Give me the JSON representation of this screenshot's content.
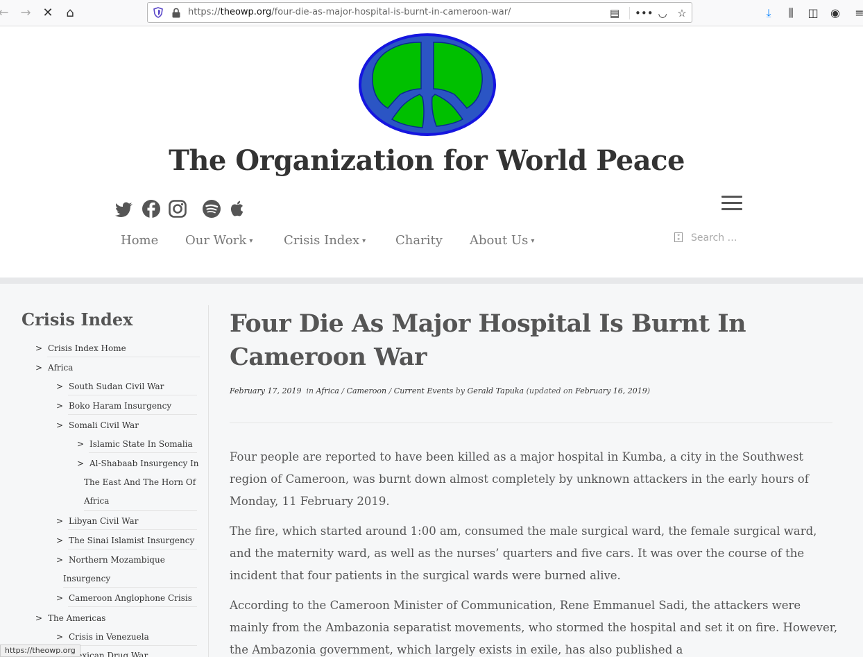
{
  "browser": {
    "url_prefix": "https://",
    "url_host": "theowp.org",
    "url_path": "/four-die-as-major-hospital-is-burnt-in-cameroon-war/",
    "status_url": "https://theowp.org"
  },
  "site": {
    "title": "The Organization for World Peace",
    "logo_colors": {
      "ring": "#1515e0",
      "fill": "#2b55c4",
      "leaf": "#00c000"
    },
    "social_icons": [
      "twitter-icon",
      "facebook-icon",
      "instagram-icon",
      "spotify-icon",
      "apple-icon"
    ]
  },
  "nav": {
    "items": [
      {
        "label": "Home",
        "has_dropdown": false
      },
      {
        "label": "Our Work",
        "has_dropdown": true
      },
      {
        "label": "Crisis Index",
        "has_dropdown": true
      },
      {
        "label": "Charity",
        "has_dropdown": false
      },
      {
        "label": "About Us",
        "has_dropdown": true
      }
    ],
    "caret": "▾",
    "search_placeholder": "Search …"
  },
  "sidebar": {
    "title": "Crisis Index",
    "items": [
      {
        "label": "Crisis Index Home"
      },
      {
        "label": "Africa"
      },
      {
        "label": "South Sudan Civil War"
      },
      {
        "label": "Boko Haram Insurgency"
      },
      {
        "label": "Somali Civil War"
      },
      {
        "label": "Islamic State In Somalia"
      },
      {
        "label": "Al-Shabaab Insurgency In",
        "cont1": "The East And The Horn Of",
        "cont2": "Africa"
      },
      {
        "label": "Libyan Civil War"
      },
      {
        "label": "The Sinai Islamist Insurgency"
      },
      {
        "label": "Northern Mozambique",
        "cont1": "Insurgency"
      },
      {
        "label": "Cameroon Anglophone Crisis"
      },
      {
        "label": "The Americas"
      },
      {
        "label": "Crisis in Venezuela"
      },
      {
        "label": "Mexican Drug War"
      }
    ]
  },
  "article": {
    "title": "Four Die As Major Hospital Is Burnt In Cameroon War",
    "date": "February 17, 2019",
    "in_label": "in",
    "categories": [
      "Africa",
      "Cameroon",
      "Current Events"
    ],
    "by_label": "by",
    "author": "Gerald Tapuka",
    "updated_prefix": "(updated on",
    "updated_date": "February 16, 2019",
    "updated_suffix": ")",
    "paragraphs": [
      "Four people are reported to have been killed as a major hospital in Kumba, a city in the Southwest region of Cameroon, was burnt down almost completely by unknown attackers in the early hours of Monday, 11 February 2019.",
      "The fire, which started around 1:00 am, consumed the male surgical ward, the female surgical ward, and the maternity ward, as well as the nurses’ quarters and five cars. It was over the course of the incident that four patients in the surgical wards were burned alive.",
      "According to the Cameroon Minister of Communication, Rene Emmanuel Sadi, the attackers were mainly from the Ambazonia separatist movements, who stormed the hospital and set it on fire. However, the Ambazonia government, which largely exists in exile, has also published a"
    ]
  }
}
